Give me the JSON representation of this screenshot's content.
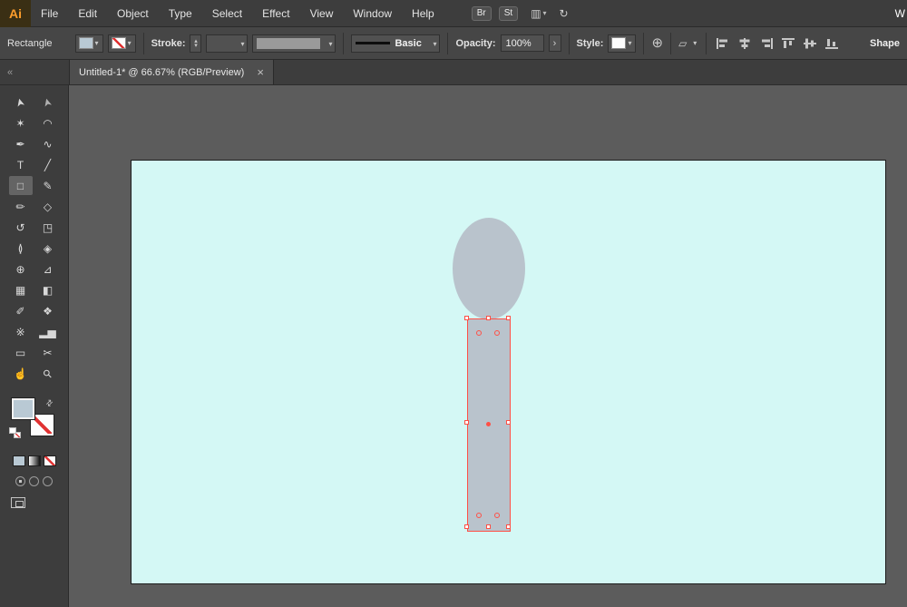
{
  "app": {
    "logo": "Ai"
  },
  "menubar": {
    "items": [
      "File",
      "Edit",
      "Object",
      "Type",
      "Select",
      "Effect",
      "View",
      "Window",
      "Help"
    ],
    "bridge_label": "Br",
    "stock_label": "St",
    "arrange_glyph": "▥",
    "dd_glyph": "▾",
    "sync_glyph": "↻",
    "right_partial": "W"
  },
  "controlbar": {
    "context_label": "Rectangle",
    "stroke_label": "Stroke:",
    "brush_label": "Basic",
    "opacity_label": "Opacity:",
    "opacity_value": "100%",
    "opacity_chevron": "›",
    "style_label": "Style:",
    "globe_glyph": "⊕",
    "transform_glyph": "▱",
    "shape_label": "Shape"
  },
  "tabbar": {
    "collapse": "«",
    "title": "Untitled-1* @ 66.67% (RGB/Preview)",
    "close": "×"
  },
  "toolbar": {
    "swap_glyph": "⇄",
    "tools": [
      {
        "name": "selection-tool",
        "icon": "selection-arrow-icon",
        "glyph": "➤",
        "icon_cls": "g r105",
        "cell_cls": "tool"
      },
      {
        "name": "direct-selection-tool",
        "icon": "direct-selection-arrow-icon",
        "glyph": "➤",
        "icon_cls": "g r105 dim",
        "cell_cls": "tool"
      },
      {
        "name": "magic-wand-tool",
        "icon": "magic-wand-icon",
        "glyph": "✶",
        "icon_cls": "g",
        "cell_cls": "tool"
      },
      {
        "name": "lasso-tool",
        "icon": "lasso-icon",
        "glyph": "◠",
        "icon_cls": "g",
        "cell_cls": "tool"
      },
      {
        "name": "pen-tool",
        "icon": "pen-nib-icon",
        "glyph": "✒",
        "icon_cls": "g",
        "cell_cls": "tool"
      },
      {
        "name": "curvature-tool",
        "icon": "curvature-icon",
        "glyph": "∿",
        "icon_cls": "g",
        "cell_cls": "tool"
      },
      {
        "name": "type-tool",
        "icon": "type-icon",
        "glyph": "T",
        "icon_cls": "g",
        "cell_cls": "tool"
      },
      {
        "name": "line-segment-tool",
        "icon": "line-segment-icon",
        "glyph": "╱",
        "icon_cls": "g",
        "cell_cls": "tool"
      },
      {
        "name": "rectangle-tool",
        "icon": "rectangle-icon",
        "glyph": "□",
        "icon_cls": "g",
        "cell_cls": "tool selected"
      },
      {
        "name": "paintbrush-tool",
        "icon": "paintbrush-icon",
        "glyph": "✎",
        "icon_cls": "g",
        "cell_cls": "tool"
      },
      {
        "name": "pencil-tool",
        "icon": "pencil-icon",
        "glyph": "✏",
        "icon_cls": "g",
        "cell_cls": "tool"
      },
      {
        "name": "shaper-tool",
        "icon": "shaper-icon",
        "glyph": "◇",
        "icon_cls": "g",
        "cell_cls": "tool"
      },
      {
        "name": "rotate-tool",
        "icon": "rotate-icon",
        "glyph": "↺",
        "icon_cls": "g",
        "cell_cls": "tool"
      },
      {
        "name": "scale-tool",
        "icon": "scale-icon",
        "glyph": "◳",
        "icon_cls": "g",
        "cell_cls": "tool"
      },
      {
        "name": "width-tool",
        "icon": "width-icon",
        "glyph": "≬",
        "icon_cls": "g",
        "cell_cls": "tool"
      },
      {
        "name": "free-transform-tool",
        "icon": "free-transform-icon",
        "glyph": "◈",
        "icon_cls": "g",
        "cell_cls": "tool"
      },
      {
        "name": "shape-builder-tool",
        "icon": "shape-builder-icon",
        "glyph": "⊕",
        "icon_cls": "g",
        "cell_cls": "tool"
      },
      {
        "name": "perspective-grid-tool",
        "icon": "perspective-grid-icon",
        "glyph": "⊿",
        "icon_cls": "g",
        "cell_cls": "tool"
      },
      {
        "name": "mesh-tool",
        "icon": "mesh-icon",
        "glyph": "▦",
        "icon_cls": "g",
        "cell_cls": "tool"
      },
      {
        "name": "gradient-tool",
        "icon": "gradient-icon",
        "glyph": "◧",
        "icon_cls": "g",
        "cell_cls": "tool"
      },
      {
        "name": "eyedropper-tool",
        "icon": "eyedropper-icon",
        "glyph": "✐",
        "icon_cls": "g",
        "cell_cls": "tool"
      },
      {
        "name": "blend-tool",
        "icon": "blend-icon",
        "glyph": "❖",
        "icon_cls": "g",
        "cell_cls": "tool"
      },
      {
        "name": "symbol-sprayer-tool",
        "icon": "symbol-sprayer-icon",
        "glyph": "※",
        "icon_cls": "g",
        "cell_cls": "tool"
      },
      {
        "name": "column-graph-tool",
        "icon": "column-graph-icon",
        "glyph": "▂▅",
        "icon_cls": "g",
        "cell_cls": "tool"
      },
      {
        "name": "artboard-tool",
        "icon": "artboard-icon",
        "glyph": "▭",
        "icon_cls": "g",
        "cell_cls": "tool"
      },
      {
        "name": "slice-tool",
        "icon": "slice-icon",
        "glyph": "✂",
        "icon_cls": "g",
        "cell_cls": "tool"
      },
      {
        "name": "hand-tool",
        "icon": "hand-icon",
        "glyph": "☝",
        "icon_cls": "g",
        "cell_cls": "tool"
      },
      {
        "name": "zoom-tool",
        "icon": "zoom-icon",
        "glyph": "⚲",
        "icon_cls": "g r45",
        "cell_cls": "tool"
      }
    ]
  },
  "colors": {
    "artboard": "#d4f8f5",
    "shape_fill": "#b9c3cc",
    "selection": "#ff4f45",
    "fill_swatch": "#b9c9d4",
    "logo_accent": "#ff9e2c"
  }
}
